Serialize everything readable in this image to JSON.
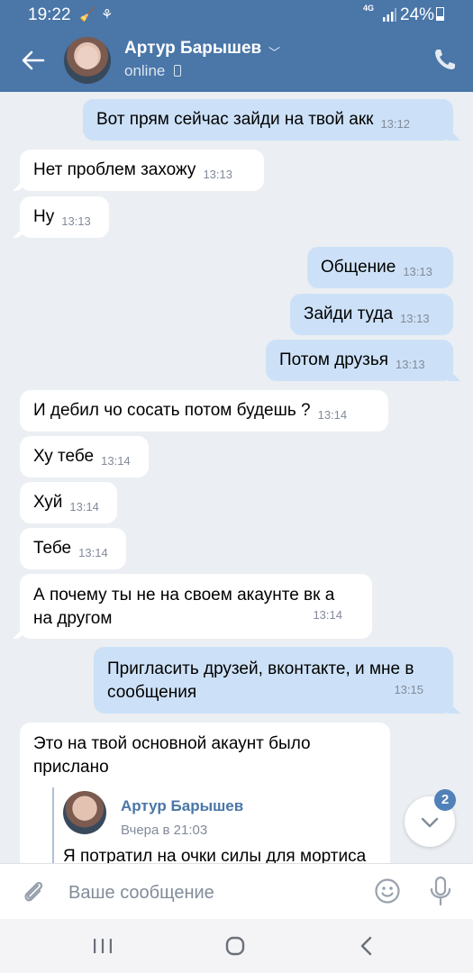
{
  "statusbar": {
    "time": "19:22",
    "network": "4G",
    "battery": "24%"
  },
  "header": {
    "name": "Артур Барышев",
    "status": "online"
  },
  "messages": [
    {
      "dir": "out",
      "text": "Вот прям сейчас зайди на твой акк",
      "time": "13:12"
    },
    {
      "dir": "in",
      "text": "Нет проблем захожу",
      "time": "13:13"
    },
    {
      "dir": "in",
      "text": "Ну",
      "time": "13:13"
    },
    {
      "dir": "out",
      "text": "Общение",
      "time": "13:13"
    },
    {
      "dir": "out",
      "text": "Зайди туда",
      "time": "13:13"
    },
    {
      "dir": "out",
      "text": "Потом друзья",
      "time": "13:13"
    },
    {
      "dir": "in",
      "text": "И дебил чо сосать потом будешь ?",
      "time": "13:14"
    },
    {
      "dir": "in",
      "text": "Ху тебе",
      "time": "13:14"
    },
    {
      "dir": "in",
      "text": "Хуй",
      "time": "13:14"
    },
    {
      "dir": "in",
      "text": "Тебе",
      "time": "13:14"
    },
    {
      "dir": "in",
      "text": "А почему ты не на своем акаунте вк а на другом",
      "time": "13:14"
    },
    {
      "dir": "out",
      "text": "Пригласить друзей, вконтакте, и мне в сообщения",
      "time": "13:15"
    },
    {
      "dir": "in",
      "text": "Это на твой основной акаунт было прислано",
      "time": ""
    }
  ],
  "forwarded": {
    "name": "Артур Барышев",
    "date": "Вчера в 21:03",
    "text": "Я потратил на очки силы для мортиса"
  },
  "scroll_down": {
    "badge": "2"
  },
  "composer": {
    "placeholder": "Ваше сообщение"
  },
  "colors": {
    "header": "#4a76a8",
    "background": "#ebeef2",
    "bubble_out": "#cce1f7",
    "bubble_in": "#ffffff",
    "accent": "#5181b8"
  },
  "icons": [
    "back-arrow-icon",
    "phone-icon",
    "paperclip-icon",
    "smile-icon",
    "microphone-icon",
    "chevron-down-icon",
    "recent-apps-icon",
    "home-icon",
    "nav-back-icon"
  ]
}
